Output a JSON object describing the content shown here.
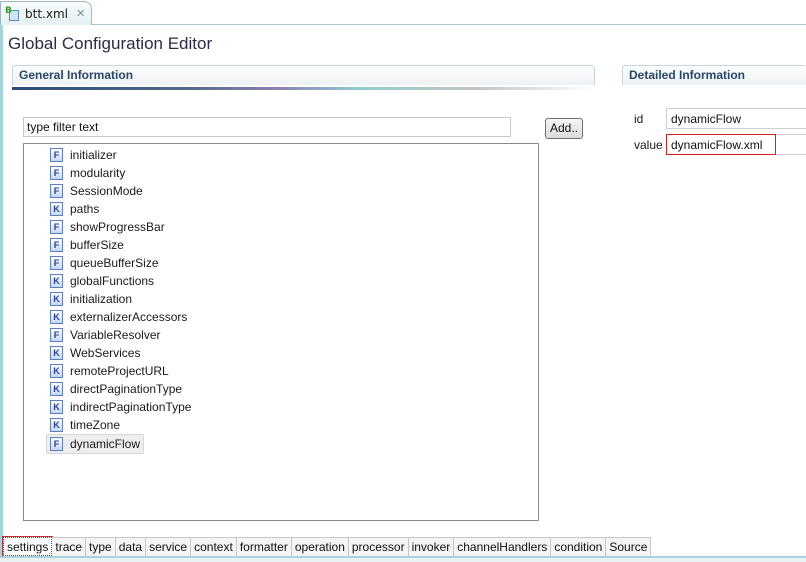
{
  "editor_tab": {
    "label": "btt.xml",
    "icon": "xml-file-icon",
    "close_icon": "close-icon"
  },
  "page_title": "Global Configuration Editor",
  "general": {
    "title": "General Information",
    "filter": {
      "value": "type filter text",
      "placeholder": "type filter text"
    },
    "add_label": "Add..",
    "items": [
      {
        "kind": "F",
        "label": "initializer"
      },
      {
        "kind": "F",
        "label": "modularity"
      },
      {
        "kind": "F",
        "label": "SessionMode"
      },
      {
        "kind": "K",
        "label": "paths"
      },
      {
        "kind": "F",
        "label": "showProgressBar"
      },
      {
        "kind": "F",
        "label": "bufferSize"
      },
      {
        "kind": "F",
        "label": "queueBufferSize"
      },
      {
        "kind": "K",
        "label": "globalFunctions"
      },
      {
        "kind": "K",
        "label": "initialization"
      },
      {
        "kind": "K",
        "label": "externalizerAccessors"
      },
      {
        "kind": "F",
        "label": "VariableResolver"
      },
      {
        "kind": "K",
        "label": "WebServices"
      },
      {
        "kind": "K",
        "label": "remoteProjectURL"
      },
      {
        "kind": "K",
        "label": "directPaginationType"
      },
      {
        "kind": "K",
        "label": "indirectPaginationType"
      },
      {
        "kind": "K",
        "label": "timeZone"
      },
      {
        "kind": "F",
        "label": "dynamicFlow",
        "selected": true
      }
    ]
  },
  "detail": {
    "title": "Detailed Information",
    "id_label": "id",
    "id_value": "dynamicFlow",
    "value_label": "value",
    "value_value": "dynamicFlow.xml"
  },
  "bottom_tabs": [
    {
      "label": "settings",
      "active": true
    },
    {
      "label": "trace"
    },
    {
      "label": "type"
    },
    {
      "label": "data"
    },
    {
      "label": "service"
    },
    {
      "label": "context"
    },
    {
      "label": "formatter"
    },
    {
      "label": "operation"
    },
    {
      "label": "processor"
    },
    {
      "label": "invoker"
    },
    {
      "label": "channelHandlers"
    },
    {
      "label": "condition"
    },
    {
      "label": "Source"
    }
  ]
}
